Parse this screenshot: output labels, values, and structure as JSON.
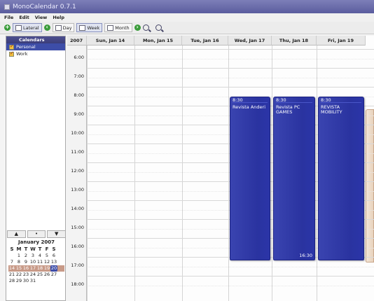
{
  "window": {
    "title": "MonoCalendar 0.7.1"
  },
  "menu": [
    "File",
    "Edit",
    "View",
    "Help"
  ],
  "toolbar": {
    "lateral": "Lateral",
    "day": "Day",
    "week": "Week",
    "month": "Month"
  },
  "sidebar": {
    "header": "Calendars",
    "calendars": [
      "Personal",
      "Work"
    ]
  },
  "mini_calendar": {
    "month": "January 2007",
    "weekday_headers": [
      "S",
      "M",
      "T",
      "W",
      "T",
      "F",
      "S"
    ],
    "weeks": [
      [
        "",
        "1",
        "2",
        "3",
        "4",
        "5",
        "6"
      ],
      [
        "7",
        "8",
        "9",
        "10",
        "11",
        "12",
        "13"
      ],
      [
        "14",
        "15",
        "16",
        "17",
        "18",
        "19",
        "20"
      ],
      [
        "21",
        "22",
        "23",
        "24",
        "25",
        "26",
        "27"
      ],
      [
        "28",
        "29",
        "30",
        "31",
        "",
        "",
        ""
      ]
    ],
    "selected_week_index": 2
  },
  "week_view": {
    "year": "2007",
    "days": [
      "Sun, Jan 14",
      "Mon, Jan 15",
      "Tue, Jan 16",
      "Wed, Jan 17",
      "Thu, Jan 18",
      "Fri, Jan 19"
    ],
    "hours": [
      "6:00",
      "7:00",
      "8:00",
      "9:00",
      "10:00",
      "11:00",
      "12:00",
      "13:00",
      "14:00",
      "15:00",
      "16:00",
      "17:00",
      "18:00"
    ]
  },
  "events": [
    {
      "day_index": 3,
      "start": "8:30",
      "title": "Revista Anderi",
      "end": ""
    },
    {
      "day_index": 4,
      "start": "8:30",
      "title": "Revista PC GAMES",
      "end": "16:30"
    },
    {
      "day_index": 5,
      "start": "8:30",
      "title": "REVISTA MOBILITY",
      "end": ""
    }
  ]
}
